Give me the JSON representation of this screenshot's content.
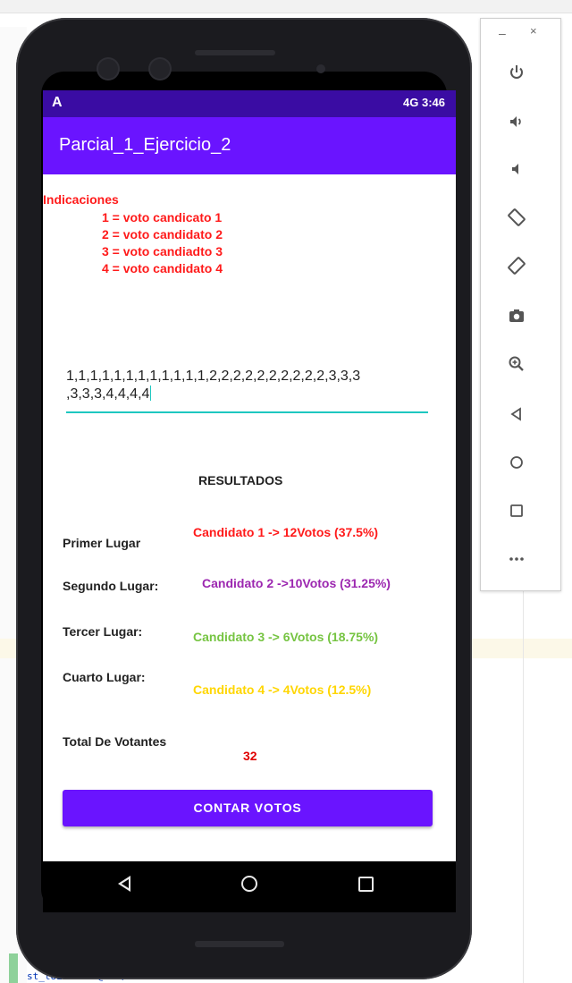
{
  "ide": {
    "bottom_code": "st_toEndOf=\"@+id/textViewtotal\""
  },
  "status_bar": {
    "left_icon": "A",
    "right_text": "4G 3:46"
  },
  "app": {
    "title": "Parcial_1_Ejercicio_2"
  },
  "indications": {
    "title": "Indicaciones",
    "lines": [
      "1 = voto candicato 1",
      "2 = voto candidato 2",
      "3 = voto candiadto 3",
      "4 = voto candidato 4"
    ]
  },
  "votes_input": {
    "line1": "1,1,1,1,1,1,1,1,1,1,1,1,2,2,2,2,2,2,2,2,2,2,3,3,3",
    "line2": ",3,3,3,4,4,4,4"
  },
  "results": {
    "title": "RESULTADOS",
    "rows": [
      {
        "label": "Primer Lugar",
        "value": "Candidato 1 -> 12Votos  (37.5%)",
        "color": "#ff1a1a"
      },
      {
        "label": "Segundo Lugar:",
        "value": "Candidato 2 ->10Votos (31.25%)",
        "color": "#9c27b0"
      },
      {
        "label": "Tercer Lugar:",
        "value": "Candidato 3 -> 6Votos (18.75%)",
        "color": "#76c442"
      },
      {
        "label": "Cuarto Lugar:",
        "value": "Candidato 4 -> 4Votos (12.5%)",
        "color": "#ffd600"
      }
    ],
    "total_label": "Total De Votantes",
    "total_value": "32"
  },
  "button": {
    "label": "CONTAR VOTOS"
  },
  "emulator_toolbar": {
    "minimize": "–",
    "close": "×",
    "items": [
      "power-icon",
      "volume-up-icon",
      "volume-down-icon",
      "rotate-left-icon",
      "rotate-right-icon",
      "camera-icon",
      "zoom-icon",
      "back-icon",
      "home-icon",
      "overview-icon",
      "more-icon"
    ]
  },
  "colors": {
    "status_bar": "#3a0ca3",
    "app_bar": "#6a14ff",
    "accent": "#1ec7c0"
  }
}
